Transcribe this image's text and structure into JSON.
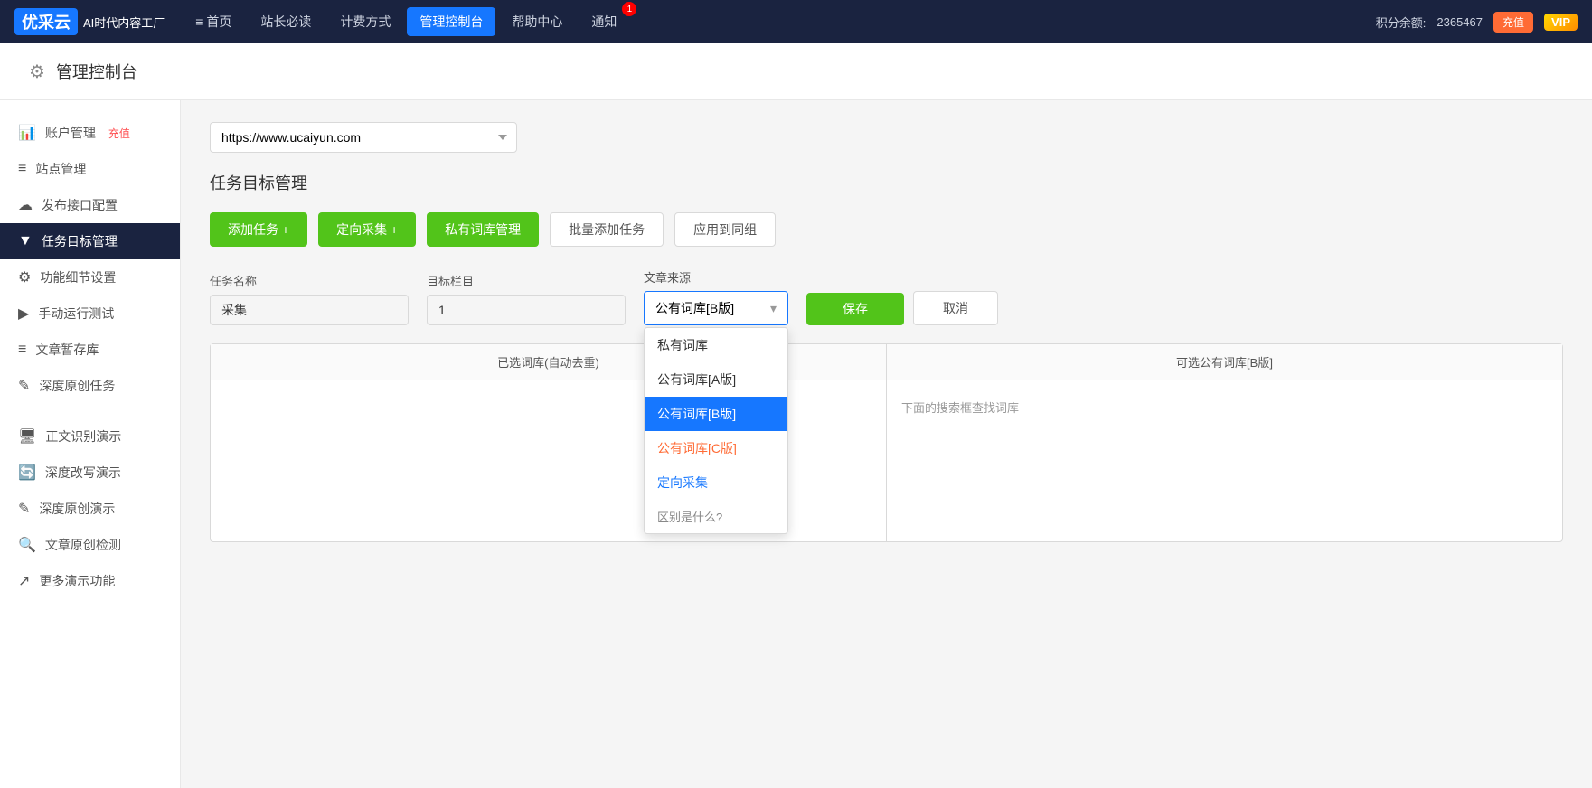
{
  "topnav": {
    "logo_box": "优采云",
    "logo_subtitle": "AI时代内容工厂",
    "nav_items": [
      {
        "label": "≡ 首页",
        "active": false
      },
      {
        "label": "站长必读",
        "active": false
      },
      {
        "label": "计费方式",
        "active": false
      },
      {
        "label": "管理控制台",
        "active": true
      },
      {
        "label": "帮助中心",
        "active": false
      },
      {
        "label": "通知",
        "active": false
      }
    ],
    "notif_count": "1",
    "score_label": "积分余额:",
    "score_value": "2365467",
    "recharge_label": "充值",
    "vip_label": "VIP"
  },
  "page_header": {
    "icon": "⚙",
    "title": "管理控制台"
  },
  "sidebar": {
    "items": [
      {
        "id": "account",
        "icon": "📊",
        "label": "账户管理",
        "recharge": "充值",
        "active": false
      },
      {
        "id": "site",
        "icon": "≡",
        "label": "站点管理",
        "active": false
      },
      {
        "id": "publish",
        "icon": "☁",
        "label": "发布接口配置",
        "active": false
      },
      {
        "id": "task",
        "icon": "▼",
        "label": "任务目标管理",
        "active": true
      },
      {
        "id": "settings",
        "icon": "⚙",
        "label": "功能细节设置",
        "active": false
      },
      {
        "id": "manual",
        "icon": "▶",
        "label": "手动运行测试",
        "active": false
      },
      {
        "id": "draft",
        "icon": "≡",
        "label": "文章暂存库",
        "active": false
      },
      {
        "id": "deeporig",
        "icon": "✎",
        "label": "深度原创任务",
        "active": false
      },
      {
        "id": "ocr",
        "icon": "🖥",
        "label": "正文识别演示",
        "active": false
      },
      {
        "id": "rewrite",
        "icon": "🔄",
        "label": "深度改写演示",
        "active": false
      },
      {
        "id": "origdemo",
        "icon": "✎",
        "label": "深度原创演示",
        "active": false
      },
      {
        "id": "check",
        "icon": "🔍",
        "label": "文章原创检测",
        "active": false
      },
      {
        "id": "more",
        "icon": "↗",
        "label": "更多演示功能",
        "active": false
      }
    ]
  },
  "main": {
    "site_select": {
      "value": "https://www.ucaiyun.com",
      "options": [
        "https://www.ucaiyun.com"
      ]
    },
    "section_title": "任务目标管理",
    "toolbar": {
      "add_task": "添加任务 +",
      "directed_collect": "定向采集 +",
      "private_lib": "私有词库管理",
      "batch_add": "批量添加任务",
      "apply_group": "应用到同组"
    },
    "form": {
      "task_name_label": "任务名称",
      "task_name_value": "采集",
      "target_col_label": "目标栏目",
      "target_col_value": "1",
      "source_label": "文章来源",
      "source_selected": "公有词库[B版]",
      "save_label": "保存",
      "cancel_label": "取消"
    },
    "source_dropdown": {
      "options": [
        {
          "label": "私有词库",
          "type": "normal"
        },
        {
          "label": "公有词库[A版]",
          "type": "normal"
        },
        {
          "label": "公有词库[B版]",
          "type": "selected"
        },
        {
          "label": "公有词库[C版]",
          "type": "c-version"
        },
        {
          "label": "定向采集",
          "type": "directional"
        },
        {
          "label": "区别是什么?",
          "type": "diff-link"
        }
      ]
    },
    "wordlist": {
      "left_header": "已选词库(自动去重)",
      "right_header": "可选公有词库[B版]",
      "right_hint": "下面的搜索框查找词库"
    }
  }
}
